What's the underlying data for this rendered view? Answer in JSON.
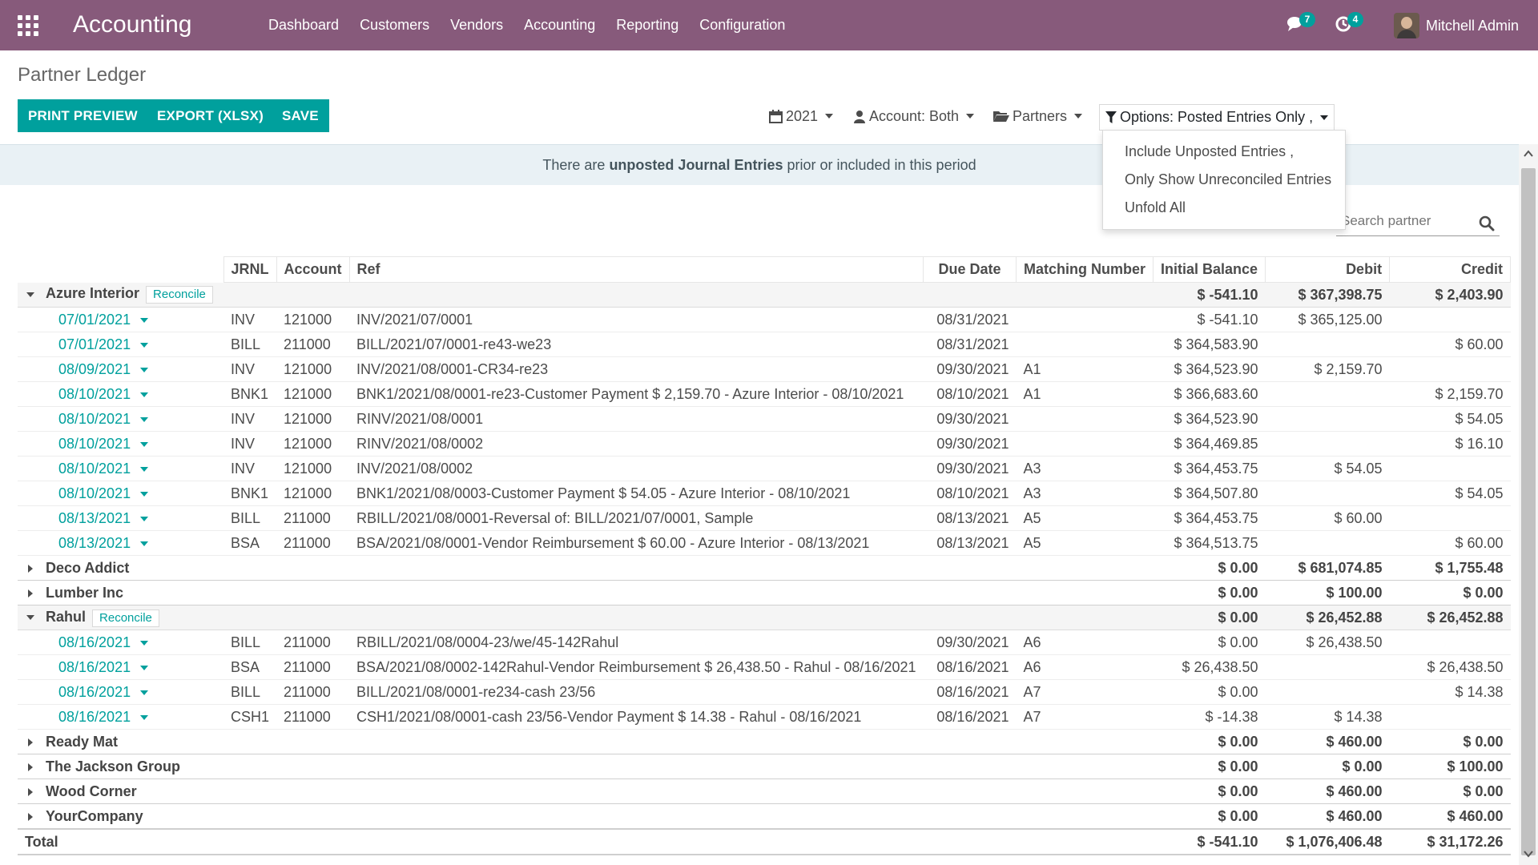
{
  "navbar": {
    "brand": "Accounting",
    "menu": [
      "Dashboard",
      "Customers",
      "Vendors",
      "Accounting",
      "Reporting",
      "Configuration"
    ],
    "messages_badge": "7",
    "activities_badge": "4",
    "user_name": "Mitchell Admin",
    "bg_color": "#875a7b"
  },
  "page": {
    "title": "Partner Ledger",
    "buttons": {
      "print": "PRINT PREVIEW",
      "export": "EXPORT (XLSX)",
      "save": "SAVE"
    },
    "filters": {
      "year": "2021",
      "account": "Account: Both",
      "partners": "Partners",
      "options": "Options: Posted Entries Only ,"
    },
    "options_menu": [
      "Include Unposted Entries ,",
      "Only Show Unreconciled Entries",
      "Unfold All"
    ],
    "alert": {
      "prefix": "There are ",
      "bold": "unposted Journal Entries",
      "suffix": " prior or included in this period"
    },
    "search_placeholder": "Search partner",
    "accent_color": "#00a09d"
  },
  "table": {
    "headers": {
      "jrnl": "JRNL",
      "account": "Account",
      "ref": "Ref",
      "due": "Due Date",
      "matching": "Matching Number",
      "initial": "Initial Balance",
      "debit": "Debit",
      "credit": "Credit"
    },
    "reconcile_label": "Reconcile",
    "partners": [
      {
        "name": "Azure Interior",
        "initial": "$ -541.10",
        "debit": "$ 367,398.75",
        "credit": "$ 2,403.90",
        "lines": [
          {
            "date": "07/01/2021",
            "jrnl": "INV",
            "account": "121000",
            "ref": "INV/2021/07/0001",
            "due": "08/31/2021",
            "match": "",
            "initial": "$ -541.10",
            "debit": "$ 365,125.00",
            "credit": ""
          },
          {
            "date": "07/01/2021",
            "jrnl": "BILL",
            "account": "211000",
            "ref": "BILL/2021/07/0001-re43-we23",
            "due": "08/31/2021",
            "match": "",
            "initial": "$ 364,583.90",
            "debit": "",
            "credit": "$ 60.00"
          },
          {
            "date": "08/09/2021",
            "jrnl": "INV",
            "account": "121000",
            "ref": "INV/2021/08/0001-CR34-re23",
            "due": "09/30/2021",
            "match": "A1",
            "initial": "$ 364,523.90",
            "debit": "$ 2,159.70",
            "credit": ""
          },
          {
            "date": "08/10/2021",
            "jrnl": "BNK1",
            "account": "121000",
            "ref": "BNK1/2021/08/0001-re23-Customer Payment $ 2,159.70 - Azure Interior - 08/10/2021",
            "due": "08/10/2021",
            "match": "A1",
            "initial": "$ 366,683.60",
            "debit": "",
            "credit": "$ 2,159.70"
          },
          {
            "date": "08/10/2021",
            "jrnl": "INV",
            "account": "121000",
            "ref": "RINV/2021/08/0001",
            "due": "09/30/2021",
            "match": "",
            "initial": "$ 364,523.90",
            "debit": "",
            "credit": "$ 54.05"
          },
          {
            "date": "08/10/2021",
            "jrnl": "INV",
            "account": "121000",
            "ref": "RINV/2021/08/0002",
            "due": "09/30/2021",
            "match": "",
            "initial": "$ 364,469.85",
            "debit": "",
            "credit": "$ 16.10"
          },
          {
            "date": "08/10/2021",
            "jrnl": "INV",
            "account": "121000",
            "ref": "INV/2021/08/0002",
            "due": "09/30/2021",
            "match": "A3",
            "initial": "$ 364,453.75",
            "debit": "$ 54.05",
            "credit": ""
          },
          {
            "date": "08/10/2021",
            "jrnl": "BNK1",
            "account": "121000",
            "ref": "BNK1/2021/08/0003-Customer Payment $ 54.05 - Azure Interior - 08/10/2021",
            "due": "08/10/2021",
            "match": "A3",
            "initial": "$ 364,507.80",
            "debit": "",
            "credit": "$ 54.05"
          },
          {
            "date": "08/13/2021",
            "jrnl": "BILL",
            "account": "211000",
            "ref": "RBILL/2021/08/0001-Reversal of: BILL/2021/07/0001, Sample",
            "due": "08/13/2021",
            "match": "A5",
            "initial": "$ 364,453.75",
            "debit": "$ 60.00",
            "credit": ""
          },
          {
            "date": "08/13/2021",
            "jrnl": "BSA",
            "account": "211000",
            "ref": "BSA/2021/08/0001-Vendor Reimbursement $ 60.00 - Azure Interior - 08/13/2021",
            "due": "08/13/2021",
            "match": "A5",
            "initial": "$ 364,513.75",
            "debit": "",
            "credit": "$ 60.00"
          }
        ]
      },
      {
        "name": "Deco Addict",
        "initial": "$ 0.00",
        "debit": "$ 681,074.85",
        "credit": "$ 1,755.48",
        "lines": []
      },
      {
        "name": "Lumber Inc",
        "initial": "$ 0.00",
        "debit": "$ 100.00",
        "credit": "$ 0.00",
        "lines": []
      },
      {
        "name": "Rahul",
        "initial": "$ 0.00",
        "debit": "$ 26,452.88",
        "credit": "$ 26,452.88",
        "lines": [
          {
            "date": "08/16/2021",
            "jrnl": "BILL",
            "account": "211000",
            "ref": "RBILL/2021/08/0004-23/we/45-142Rahul",
            "due": "09/30/2021",
            "match": "A6",
            "initial": "$ 0.00",
            "debit": "$ 26,438.50",
            "credit": ""
          },
          {
            "date": "08/16/2021",
            "jrnl": "BSA",
            "account": "211000",
            "ref": "BSA/2021/08/0002-142Rahul-Vendor Reimbursement $ 26,438.50 - Rahul - 08/16/2021",
            "due": "08/16/2021",
            "match": "A6",
            "initial": "$ 26,438.50",
            "debit": "",
            "credit": "$ 26,438.50"
          },
          {
            "date": "08/16/2021",
            "jrnl": "BILL",
            "account": "211000",
            "ref": "BILL/2021/08/0001-re234-cash 23/56",
            "due": "08/16/2021",
            "match": "A7",
            "initial": "$ 0.00",
            "debit": "",
            "credit": "$ 14.38"
          },
          {
            "date": "08/16/2021",
            "jrnl": "CSH1",
            "account": "211000",
            "ref": "CSH1/2021/08/0001-cash 23/56-Vendor Payment $ 14.38 - Rahul - 08/16/2021",
            "due": "08/16/2021",
            "match": "A7",
            "initial": "$ -14.38",
            "debit": "$ 14.38",
            "credit": ""
          }
        ]
      },
      {
        "name": "Ready Mat",
        "initial": "$ 0.00",
        "debit": "$ 460.00",
        "credit": "$ 0.00",
        "lines": []
      },
      {
        "name": "The Jackson Group",
        "initial": "$ 0.00",
        "debit": "$ 0.00",
        "credit": "$ 100.00",
        "lines": []
      },
      {
        "name": "Wood Corner",
        "initial": "$ 0.00",
        "debit": "$ 460.00",
        "credit": "$ 0.00",
        "lines": []
      },
      {
        "name": "YourCompany",
        "initial": "$ 0.00",
        "debit": "$ 460.00",
        "credit": "$ 460.00",
        "lines": []
      }
    ],
    "total": {
      "label": "Total",
      "initial": "$ -541.10",
      "debit": "$ 1,076,406.48",
      "credit": "$ 31,172.26"
    }
  }
}
